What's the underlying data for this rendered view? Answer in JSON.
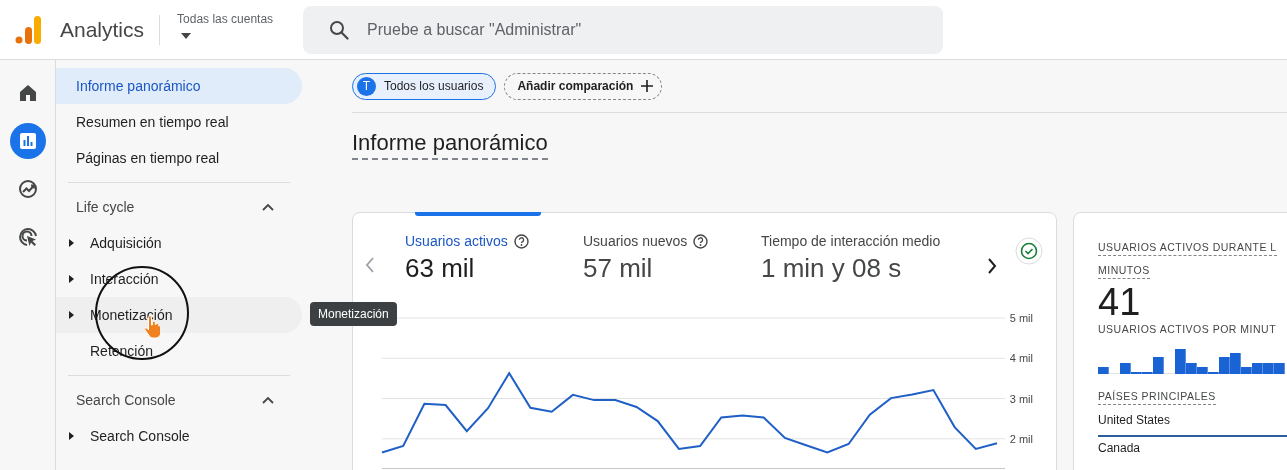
{
  "header": {
    "product": "Analytics",
    "account": "Todas las cuentas",
    "search": {
      "placeholder": "Pruebe a buscar \"Administrar\""
    }
  },
  "rail": [
    {
      "selected": false
    },
    {
      "selected": true
    },
    {
      "selected": false
    },
    {
      "selected": false
    }
  ],
  "sidebar": {
    "items": [
      {
        "label": "Informe panorámico",
        "selected": true
      },
      {
        "label": "Resumen en tiempo real",
        "selected": false
      },
      {
        "label": "Páginas en tiempo real",
        "selected": false
      }
    ],
    "sections": [
      {
        "title": "Life cycle",
        "expanded": true,
        "items": [
          {
            "label": "Adquisición",
            "hovered": false
          },
          {
            "label": "Interacción",
            "hovered": false
          },
          {
            "label": "Monetización",
            "hovered": true
          },
          {
            "label": "Retención",
            "hovered": false,
            "leaf": true
          }
        ]
      },
      {
        "title": "Search Console",
        "expanded": true,
        "items": [
          {
            "label": "Search Console",
            "hovered": false
          }
        ]
      }
    ]
  },
  "tooltip": "Monetización",
  "comparisons": {
    "chips": [
      {
        "badge": "T",
        "label": "Todos los usuarios"
      }
    ],
    "add_button": "Añadir comparación"
  },
  "page_title": "Informe panorámico",
  "overview_card": {
    "metrics": [
      {
        "label": "Usuarios activos",
        "value": "63 mil",
        "help": true,
        "selected": true
      },
      {
        "label": "Usuarios nuevos",
        "value": "57 mil",
        "help": true,
        "selected": false
      },
      {
        "label": "Tiempo de interacción medio",
        "value": "1 min y 08 s",
        "help": false,
        "selected": false
      }
    ],
    "verified": true,
    "chart_data": {
      "type": "line",
      "grid": true,
      "ylim": [
        1.25,
        5
      ],
      "yticks": [
        {
          "value": 5,
          "label": "5 mil"
        },
        {
          "value": 4,
          "label": "4 mil"
        },
        {
          "value": 3,
          "label": "3 mil"
        },
        {
          "value": 2,
          "label": "2 mil"
        }
      ],
      "series": [
        {
          "color": "#1f5fc6",
          "values": [
            1.66,
            1.82,
            2.87,
            2.84,
            2.19,
            2.76,
            3.63,
            2.77,
            2.67,
            3.09,
            2.96,
            2.96,
            2.79,
            2.44,
            1.75,
            1.82,
            2.53,
            2.58,
            2.53,
            2.02,
            1.84,
            1.66,
            1.87,
            2.6,
            3.01,
            3.1,
            3.21,
            2.29,
            1.75,
            1.89
          ]
        }
      ]
    }
  },
  "realtime_card": {
    "title_lines": [
      "USUARIOS ACTIVOS DURANTE L",
      "MINUTOS"
    ],
    "value": "41",
    "subtitle": "USUARIOS ACTIVOS POR MINUT",
    "countries_title": "PAÍSES PRINCIPALES",
    "countries": [
      "United States",
      "Canada"
    ]
  }
}
